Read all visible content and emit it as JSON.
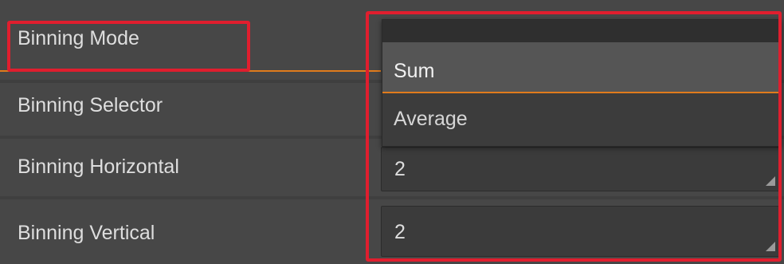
{
  "properties": [
    {
      "label": "Binning Mode"
    },
    {
      "label": "Binning Selector"
    },
    {
      "label": "Binning Horizontal",
      "value": "2"
    },
    {
      "label": "Binning Vertical",
      "value": "2"
    }
  ],
  "dropdown": {
    "options": [
      "Sum",
      "Average"
    ],
    "highlighted": "Sum"
  },
  "colors": {
    "highlight_border": "#e01e2e",
    "accent_line": "#e07b1c",
    "background": "#474747"
  }
}
